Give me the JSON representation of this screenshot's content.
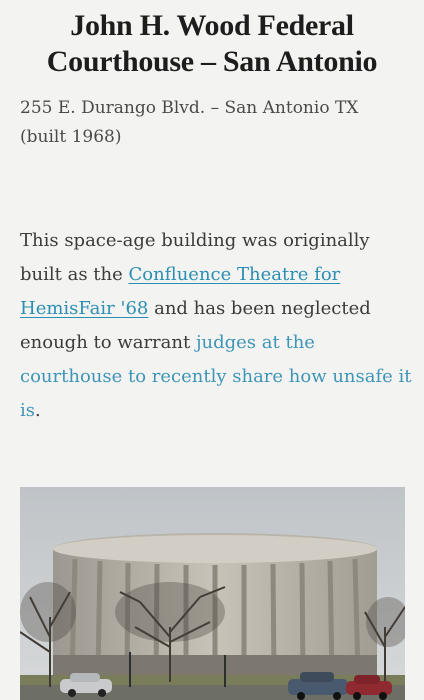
{
  "article": {
    "title_line1": "John H. Wood Federal",
    "title_line2": "Courthouse – San Antonio",
    "address_line1": "255 E. Durango Blvd. – San Antonio TX",
    "address_line2": "(built 1968)",
    "body": {
      "text_before_link1": "This space-age building was originally built as the ",
      "link1_text": "Confluence Theatre for HemisFair '68",
      "text_between": " and has been neglected enough to warrant ",
      "link2_text": "judges at the courthouse to recently share how unsafe it is",
      "text_after": "."
    },
    "photo": {
      "subject": "round-courthouse-building-photo"
    }
  },
  "colors": {
    "background": "#f3f3f1",
    "title": "#1d1d1d",
    "link": "#2a8fb2"
  }
}
